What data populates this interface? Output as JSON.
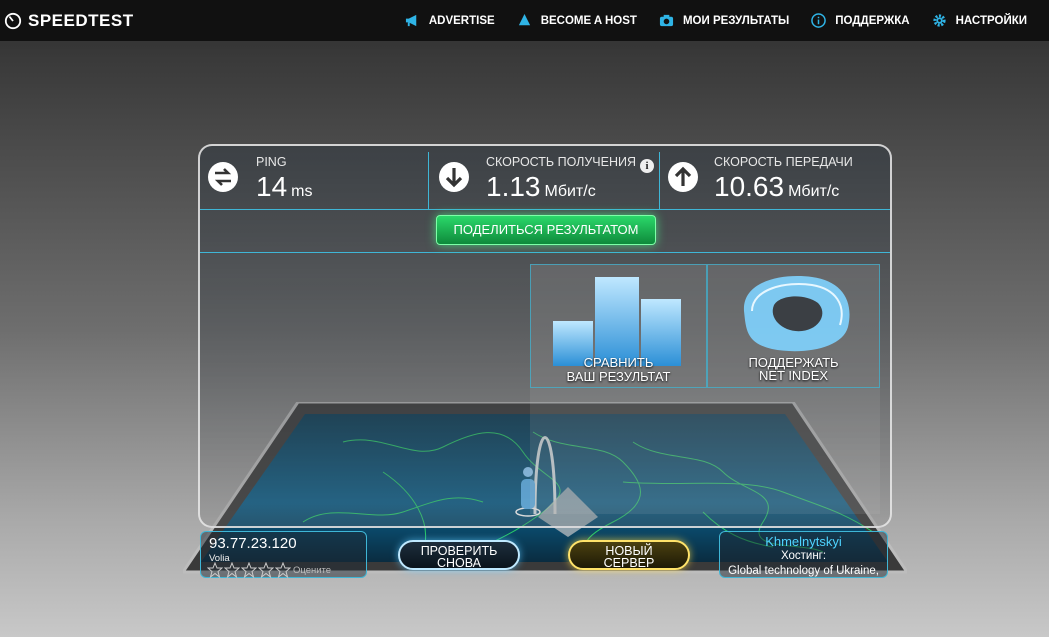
{
  "brand": {
    "name": "SPEEDTEST"
  },
  "nav": [
    {
      "label": "ADVERTISE",
      "icon": "megaphone-icon"
    },
    {
      "label": "BECOME A HOST",
      "icon": "drop-icon"
    },
    {
      "label": "МОИ РЕЗУЛЬТАТЫ",
      "icon": "camera-icon"
    },
    {
      "label": "ПОДДЕРЖКА",
      "icon": "info-icon"
    },
    {
      "label": "НАСТРОЙКИ",
      "icon": "gear-icon"
    }
  ],
  "stats": {
    "ping": {
      "label": "PING",
      "value": "14",
      "unit": "ms"
    },
    "download": {
      "label": "СКОРОСТЬ ПОЛУЧЕНИЯ",
      "value": "1.13",
      "unit": "Мбит/с"
    },
    "upload": {
      "label": "СКОРОСТЬ ПЕРЕДАЧИ",
      "value": "10.63",
      "unit": "Мбит/с"
    }
  },
  "share_label": "ПОДЕЛИТЬСЯ РЕЗУЛЬТАТОМ",
  "tiles": {
    "compare": {
      "line1": "СРАВНИТЬ",
      "line2": "ВАШ РЕЗУЛЬТАТ"
    },
    "netindex": {
      "line1": "ПОДДЕРЖАТЬ",
      "line2": "NET INDEX"
    }
  },
  "client": {
    "ip": "93.77.23.120",
    "isp": "Volia",
    "rate_label": "Оцените",
    "rating": 0,
    "max_rating": 5
  },
  "buttons": {
    "again": {
      "line1": "ПРОВЕРИТЬ",
      "line2": "СНОВА"
    },
    "new_server": {
      "line1": "НОВЫЙ",
      "line2": "СЕРВЕР"
    }
  },
  "server": {
    "city": "Khmelnytskyi",
    "host_label": "Хостинг:",
    "host_name": "Global technology of Ukraine,"
  },
  "colors": {
    "accent": "#3fb6d6",
    "share": "#22c95e",
    "new_server": "#ffe36a"
  }
}
